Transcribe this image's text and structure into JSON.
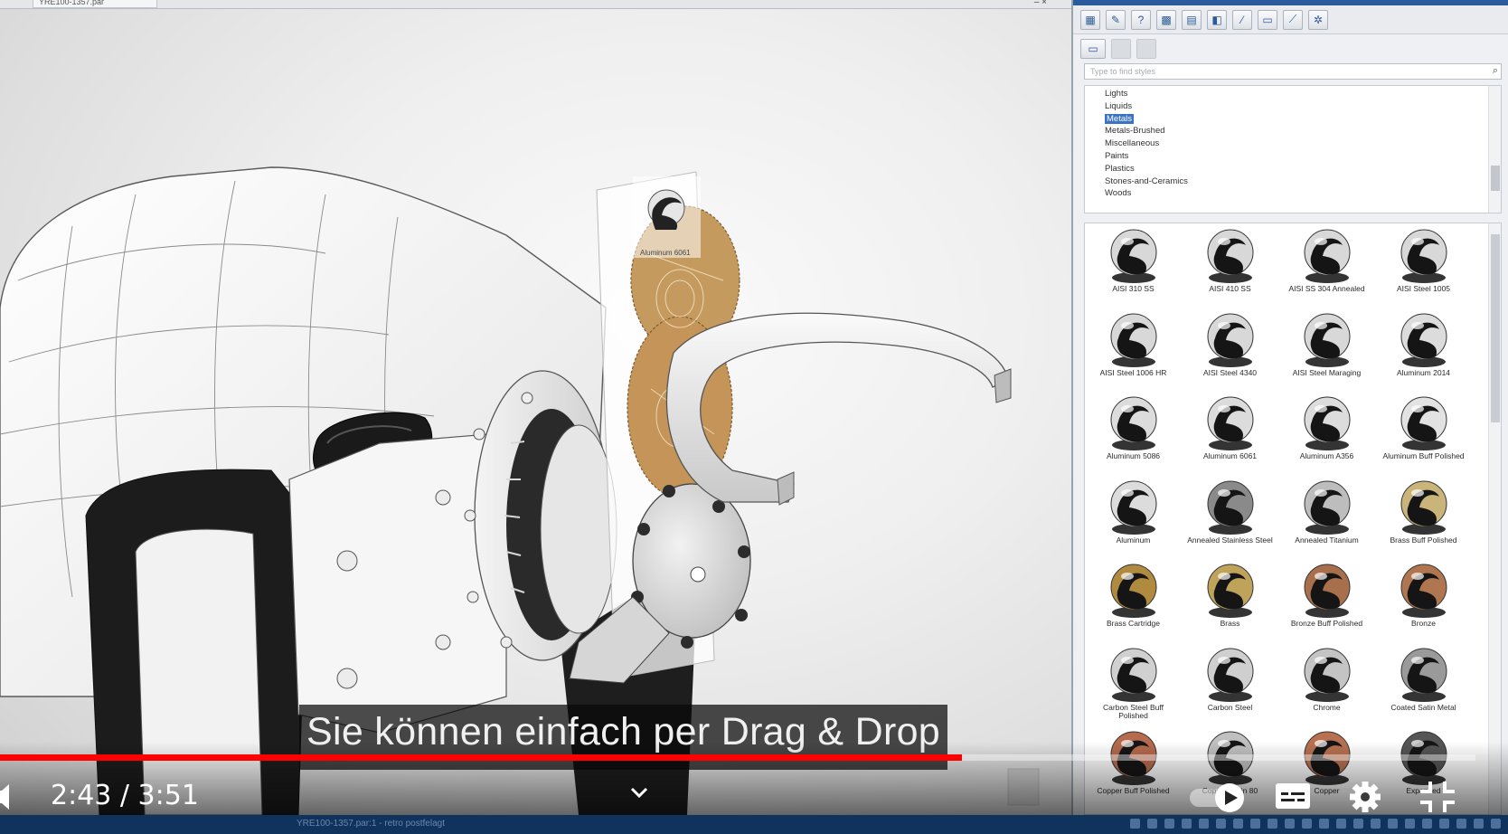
{
  "document_tab": {
    "title": "YRE100-1357.par"
  },
  "panel": {
    "search": {
      "placeholder": "Type to find styles"
    },
    "categories": [
      {
        "label": "Lights",
        "selected": false
      },
      {
        "label": "Liquids",
        "selected": false
      },
      {
        "label": "Metals",
        "selected": true
      },
      {
        "label": "Metals-Brushed",
        "selected": false
      },
      {
        "label": "Miscellaneous",
        "selected": false
      },
      {
        "label": "Paints",
        "selected": false
      },
      {
        "label": "Plastics",
        "selected": false
      },
      {
        "label": "Stones-and-Ceramics",
        "selected": false
      },
      {
        "label": "Woods",
        "selected": false
      }
    ],
    "materials": [
      {
        "label": "AISI 310 SS",
        "tint": "#d8d8d8"
      },
      {
        "label": "AISI 410 SS",
        "tint": "#d8d8d8"
      },
      {
        "label": "AISI SS 304 Annealed",
        "tint": "#d8d8d8"
      },
      {
        "label": "AISI Steel 1005",
        "tint": "#d8d8d8"
      },
      {
        "label": "AISI Steel 1006 HR",
        "tint": "#d8d8d8"
      },
      {
        "label": "AISI Steel 4340",
        "tint": "#d8d8d8"
      },
      {
        "label": "AISI Steel Maraging",
        "tint": "#d8d8d8"
      },
      {
        "label": "Aluminum 2014",
        "tint": "#dcdcdc"
      },
      {
        "label": "Aluminum 5086",
        "tint": "#dcdcdc"
      },
      {
        "label": "Aluminum 6061",
        "tint": "#dcdcdc"
      },
      {
        "label": "Aluminum A356",
        "tint": "#dcdcdc"
      },
      {
        "label": "Aluminum Buff Polished",
        "tint": "#e2e2e2"
      },
      {
        "label": "Aluminum",
        "tint": "#dcdcdc"
      },
      {
        "label": "Annealed Stainless Steel",
        "tint": "#8a8a8a"
      },
      {
        "label": "Annealed Titanium",
        "tint": "#bdbdbd"
      },
      {
        "label": "Brass Buff Polished",
        "tint": "#c9b47a"
      },
      {
        "label": "Brass Cartridge",
        "tint": "#b08a3e"
      },
      {
        "label": "Brass",
        "tint": "#bfa35a"
      },
      {
        "label": "Bronze Buff Polished",
        "tint": "#a86f4c"
      },
      {
        "label": "Bronze",
        "tint": "#b07650"
      },
      {
        "label": "Carbon Steel Buff Polished",
        "tint": "#d0d0d0"
      },
      {
        "label": "Carbon Steel",
        "tint": "#cfcfcf"
      },
      {
        "label": "Chrome",
        "tint": "#c4c4c4"
      },
      {
        "label": "Coated Satin Metal",
        "tint": "#9a9a9a"
      },
      {
        "label": "Copper Buff Polished",
        "tint": "#b66a4e"
      },
      {
        "label": "Copper Satin 80",
        "tint": "#c0c0c0"
      },
      {
        "label": "Copper",
        "tint": "#b87150"
      },
      {
        "label": "Expanded",
        "tint": "#555555"
      }
    ]
  },
  "viewport": {
    "drag_tooltip": "Aluminum 6061"
  },
  "subtitle": "Sie können einfach per Drag & Drop",
  "player": {
    "time": "2:43 / 3:51",
    "progress": 0.652,
    "accent": "#ff0000"
  },
  "taskbar": {
    "status": "YRE100-1357.par:1 - retro postfelagt"
  }
}
